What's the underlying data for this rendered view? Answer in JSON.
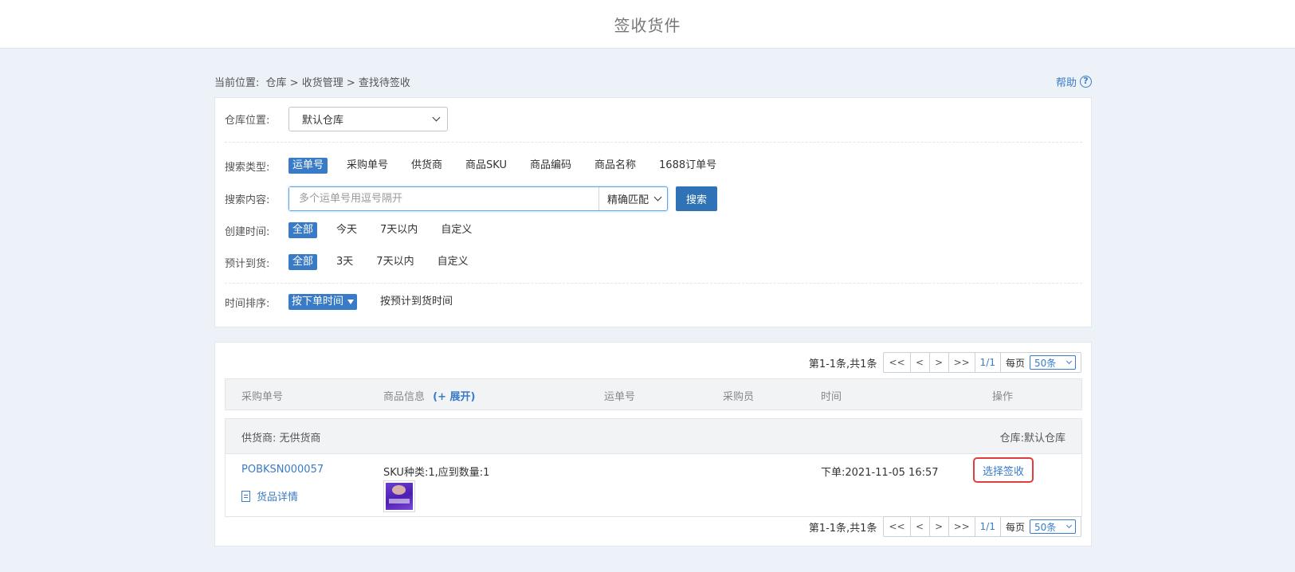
{
  "header": {
    "title": "签收货件"
  },
  "breadcrumb": {
    "prefix": "当前位置:",
    "path": "仓库 > 收货管理 > 查找待签收"
  },
  "help": {
    "label": "帮助",
    "icon": "question-circle-icon"
  },
  "filters": {
    "warehouse": {
      "label": "仓库位置:",
      "value": "默认仓库"
    },
    "search_type": {
      "label": "搜索类型:",
      "options": [
        "运单号",
        "采购单号",
        "供货商",
        "商品SKU",
        "商品编码",
        "商品名称",
        "1688订单号"
      ],
      "active": "运单号"
    },
    "search_content": {
      "label": "搜索内容:",
      "placeholder": "多个运单号用逗号隔开",
      "value": "",
      "match_mode": "精确匹配",
      "button": "搜索"
    },
    "created_time": {
      "label": "创建时间:",
      "options": [
        "全部",
        "今天",
        "7天以内",
        "自定义"
      ],
      "active": "全部"
    },
    "expected_arrival": {
      "label": "预计到货:",
      "options": [
        "全部",
        "3天",
        "7天以内",
        "自定义"
      ],
      "active": "全部"
    },
    "sort": {
      "label": "时间排序:",
      "options": [
        "按下单时间",
        "按预计到货时间"
      ],
      "active": "按下单时间"
    }
  },
  "pagination": {
    "summary": "第1-1条,共1条",
    "first": "<<",
    "prev": "<",
    "next": ">",
    "last": ">>",
    "page": "1/1",
    "per_page_label": "每页",
    "per_page_value": "50条"
  },
  "table": {
    "columns": {
      "po": "采购单号",
      "goods": "商品信息",
      "expand": "(+ 展开)",
      "tracking": "运单号",
      "buyer": "采购员",
      "time": "时间",
      "action": "操作"
    },
    "groups": [
      {
        "supplier": "供货商: 无供货商",
        "warehouse": "仓库:默认仓库",
        "row": {
          "po_number": "POBKSN000057",
          "details_link": "货品详情",
          "sku_info": "SKU种类:1,应到数量:1",
          "tracking": "",
          "buyer": "",
          "time": "下单:2021-11-05 16:57",
          "action": "选择签收"
        }
      }
    ]
  },
  "colors": {
    "accent": "#3a7bc8",
    "primary_button": "#2f72b5",
    "highlight_border": "#e23c3c"
  }
}
